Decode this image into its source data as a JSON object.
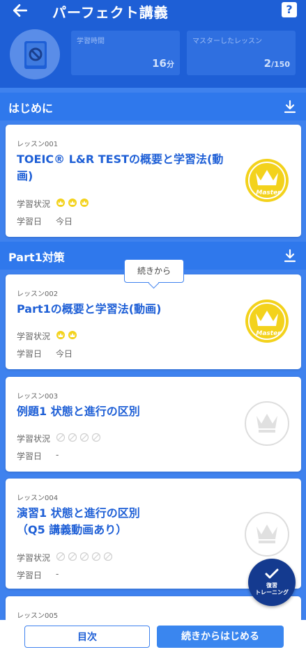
{
  "header": {
    "title": "パーフェクト講義",
    "help_label": "?",
    "stats": [
      {
        "label": "学習時間",
        "value": "16",
        "unit": "分"
      },
      {
        "label": "マスターしたレッスン",
        "value": "2",
        "unit": "/150"
      }
    ]
  },
  "sections": [
    {
      "title": "はじめに"
    },
    {
      "title": "Part1対策"
    }
  ],
  "row_labels": {
    "status": "学習状況",
    "date": "学習日"
  },
  "lessons": [
    {
      "number": "レッスン001",
      "title": "TOEIC® L&R TESTの概要と学習法(動画)",
      "status_count": 3,
      "date": "今日",
      "badge": "master",
      "badge_text": "Master"
    },
    {
      "number": "レッスン002",
      "title": "Part1の概要と学習法(動画)",
      "status_count": 2,
      "date": "今日",
      "badge": "master",
      "badge_text": "Master"
    },
    {
      "number": "レッスン003",
      "title": "例題1 状態と進行の区別",
      "status_count": 4,
      "date": "-",
      "badge": "none"
    },
    {
      "number": "レッスン004",
      "title_line1": "演習1 状態と進行の区別",
      "title_line2": "（Q5 講義動画あり）",
      "status_count": 5,
      "date": "-",
      "badge": "none"
    },
    {
      "number": "レッスン005"
    }
  ],
  "tooltip": "続きから",
  "fab": {
    "line1": "復習",
    "line2": "トレーニング"
  },
  "bottom": {
    "toc": "目次",
    "continue": "続きからはじめる"
  },
  "colors": {
    "primary": "#1e5fd6",
    "background": "#3f82ee",
    "gold": "#f3d21c"
  }
}
